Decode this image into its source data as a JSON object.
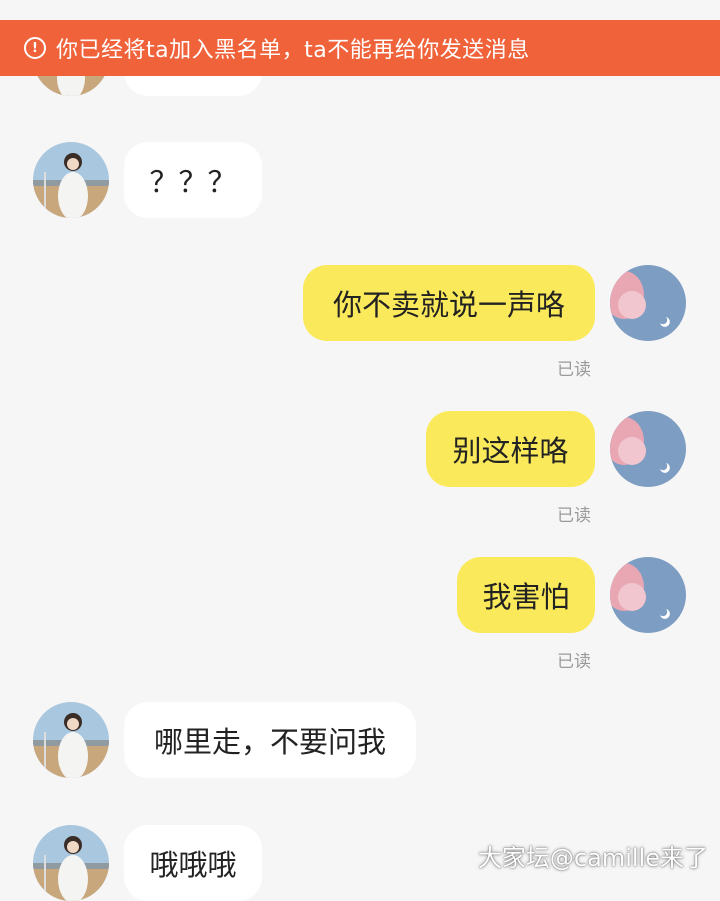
{
  "banner": {
    "icon": "alert-circle-icon",
    "text": "你已经将ta加入黑名单，ta不能再给你发送消息",
    "color": "#f0623a"
  },
  "messages": [
    {
      "side": "in",
      "text": ""
    },
    {
      "side": "in",
      "text": "？？？"
    },
    {
      "side": "out",
      "text": "你不卖就说一声咯",
      "status": "已读"
    },
    {
      "side": "out",
      "text": "别这样咯",
      "status": "已读"
    },
    {
      "side": "out",
      "text": "我害怕",
      "status": "已读"
    },
    {
      "side": "in",
      "text": "哪里走，不要问我"
    },
    {
      "side": "in",
      "text": "哦哦哦"
    }
  ],
  "colors": {
    "incoming_bubble": "#ffffff",
    "outgoing_bubble": "#fae95a",
    "background": "#f6f6f6"
  },
  "watermark": "大家坛@camille来了"
}
